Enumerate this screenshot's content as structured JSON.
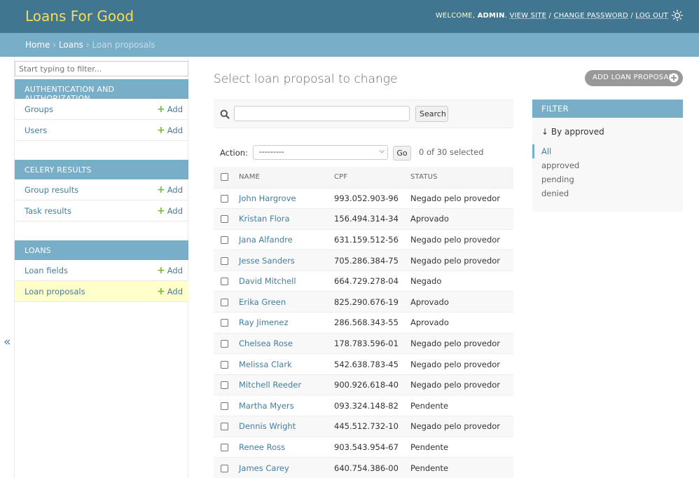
{
  "header": {
    "brand": "Loans For Good",
    "welcome": "Welcome,",
    "username": "admin",
    "view_site": "View site",
    "change_password": "Change password",
    "log_out": "Log out",
    "sep1": "/",
    "sep2": "/"
  },
  "breadcrumbs": {
    "home": "Home",
    "sep": "›",
    "loans": "Loans",
    "current": "Loan proposals"
  },
  "sidebar": {
    "filter_placeholder": "Start typing to filter...",
    "add_label": "Add",
    "modules": [
      {
        "caption": "Authentication and Authorization",
        "items": [
          "Groups",
          "Users"
        ]
      },
      {
        "caption": "Celery Results",
        "items": [
          "Group results",
          "Task results"
        ]
      },
      {
        "caption": "Loans",
        "items": [
          "Loan fields",
          "Loan proposals"
        ]
      }
    ],
    "collapse": "«"
  },
  "content": {
    "title": "Select loan proposal to change",
    "add_button": "Add Loan Proposal",
    "search_button": "Search",
    "action_label": "Action:",
    "action_value": "---------",
    "go_button": "Go",
    "selected_count": "0 of 30 selected"
  },
  "table": {
    "columns": [
      "Name",
      "CPF",
      "Status"
    ],
    "rows": [
      {
        "name": "John Hargrove",
        "cpf": "993.052.903-96",
        "status": "Negado pelo provedor"
      },
      {
        "name": "Kristan Flora",
        "cpf": "156.494.314-34",
        "status": "Aprovado"
      },
      {
        "name": "Jana Alfandre",
        "cpf": "631.159.512-56",
        "status": "Negado pelo provedor"
      },
      {
        "name": "Jesse Sanders",
        "cpf": "705.286.384-75",
        "status": "Negado pelo provedor"
      },
      {
        "name": "David Mitchell",
        "cpf": "664.729.278-04",
        "status": "Negado"
      },
      {
        "name": "Erika Green",
        "cpf": "825.290.676-19",
        "status": "Aprovado"
      },
      {
        "name": "Ray Jimenez",
        "cpf": "286.568.343-55",
        "status": "Aprovado"
      },
      {
        "name": "Chelsea Rose",
        "cpf": "178.783.596-01",
        "status": "Negado pelo provedor"
      },
      {
        "name": "Melissa Clark",
        "cpf": "542.638.783-45",
        "status": "Negado pelo provedor"
      },
      {
        "name": "Mitchell Reeder",
        "cpf": "900.926.618-40",
        "status": "Negado pelo provedor"
      },
      {
        "name": "Martha Myers",
        "cpf": "093.324.148-82",
        "status": "Pendente"
      },
      {
        "name": "Dennis Wright",
        "cpf": "445.512.732-10",
        "status": "Negado pelo provedor"
      },
      {
        "name": "Renee Ross",
        "cpf": "903.543.954-67",
        "status": "Pendente"
      },
      {
        "name": "James Carey",
        "cpf": "640.754.386-00",
        "status": "Pendente"
      }
    ]
  },
  "filter": {
    "caption": "Filter",
    "heading": "↓ By approved",
    "options": [
      "All",
      "approved",
      "pending",
      "denied"
    ],
    "selected": "All"
  },
  "colors": {
    "header_bg": "#417690",
    "brand": "#f5dd5d",
    "breadcrumb_bg": "#79aec8",
    "link": "#447e9b",
    "add_green": "#70bf2b",
    "current_row": "#ffffcc"
  }
}
